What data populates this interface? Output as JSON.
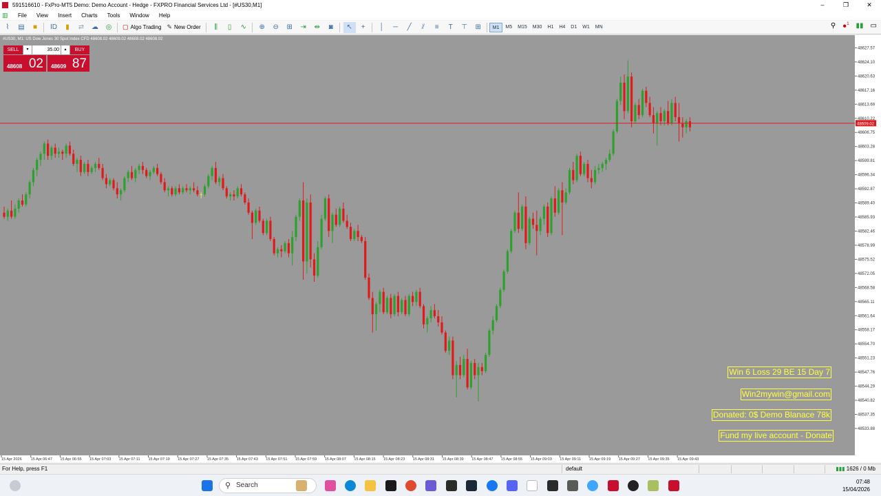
{
  "window": {
    "title": "591516610 - FxPro-MT5 Demo: Demo Account - Hedge - FXPRO Financial Services Ltd - [#US30,M1]",
    "controls": [
      "–",
      "❐",
      "✕"
    ]
  },
  "menu": [
    "File",
    "View",
    "Insert",
    "Charts",
    "Tools",
    "Window",
    "Help"
  ],
  "toolbar": {
    "algo_trading": "Algo Trading",
    "new_order": "New Order",
    "timeframes": [
      "M1",
      "M5",
      "M15",
      "M30",
      "H1",
      "H4",
      "D1",
      "W1",
      "MN"
    ],
    "active_timeframe": "M1",
    "notification_count": "1"
  },
  "chart": {
    "header": "#US30, M1: US Dow Jones 30 Spot Index CFD  48608.02 48609.02 48608.02 48608.02",
    "trade_panel": {
      "sell_label": "SELL",
      "buy_label": "BUY",
      "volume": "35.00",
      "bid_small": "48608",
      "bid_big": "02",
      "ask_small": "48609",
      "ask_big": "87"
    },
    "current_price_label": "48609.02",
    "overlay_labels": [
      "Win 6  Loss 29  BE 15  Day 7",
      "Win2mywin@gmail.com",
      "Donated: 0$  Demo Blanace 78k",
      "Fund my live account - Donate"
    ],
    "colors": {
      "background": "#9a9a9a",
      "bull": "#2ea02e",
      "bear": "#e01a1a",
      "doji": "#e8e860",
      "bid_line": "#e01a1a",
      "label_text": "#ffff40"
    }
  },
  "chart_data": {
    "type": "candlestick",
    "y_ticks": [
      "48627.57",
      "48624.10",
      "48620.63",
      "48617.16",
      "48613.69",
      "48610.22",
      "48606.75",
      "48603.28",
      "48599.81",
      "48596.34",
      "48592.87",
      "48589.40",
      "48585.93",
      "48582.46",
      "48578.99",
      "48575.52",
      "48572.05",
      "48568.58",
      "48565.11",
      "48561.64",
      "48558.17",
      "48554.70",
      "48551.23",
      "48547.76",
      "48544.29",
      "48540.82",
      "48537.35",
      "48533.88"
    ],
    "x_ticks": [
      "15 Apr 2026",
      "15 Apr 06:47",
      "15 Apr 06:55",
      "15 Apr 07:03",
      "15 Apr 07:11",
      "15 Apr 07:19",
      "15 Apr 07:27",
      "15 Apr 07:35",
      "15 Apr 07:43",
      "15 Apr 07:51",
      "15 Apr 07:59",
      "15 Apr 08:07",
      "15 Apr 08:15",
      "15 Apr 08:23",
      "15 Apr 08:31",
      "15 Apr 08:39",
      "15 Apr 08:47",
      "15 Apr 08:55",
      "15 Apr 09:03",
      "15 Apr 09:11",
      "15 Apr 09:19",
      "15 Apr 09:27",
      "15 Apr 09:35",
      "15 Apr 09:43"
    ],
    "ylim": [
      48531.5,
      48629.0
    ],
    "bid_price": 48609.02,
    "ohlc": [
      [
        48587.0,
        48588.5,
        48585.5,
        48586.0
      ],
      [
        48586.0,
        48588.0,
        48585.0,
        48587.5
      ],
      [
        48587.5,
        48590.0,
        48585.5,
        48586.0
      ],
      [
        48586.0,
        48589.0,
        48585.5,
        48588.0
      ],
      [
        48588.0,
        48590.5,
        48587.0,
        48590.0
      ],
      [
        48590.0,
        48591.5,
        48588.5,
        48589.0
      ],
      [
        48589.0,
        48592.0,
        48588.5,
        48591.5
      ],
      [
        48591.5,
        48595.0,
        48590.5,
        48594.5
      ],
      [
        48594.5,
        48598.0,
        48593.5,
        48597.5
      ],
      [
        48597.5,
        48600.5,
        48596.0,
        48600.0
      ],
      [
        48600.0,
        48602.0,
        48598.5,
        48601.5
      ],
      [
        48601.5,
        48604.5,
        48600.0,
        48604.0
      ],
      [
        48604.0,
        48605.0,
        48600.0,
        48601.0
      ],
      [
        48601.0,
        48603.5,
        48600.0,
        48603.0
      ],
      [
        48603.0,
        48604.0,
        48600.5,
        48601.5
      ],
      [
        48601.5,
        48603.0,
        48600.5,
        48602.0
      ],
      [
        48602.0,
        48602.5,
        48600.0,
        48601.5
      ],
      [
        48601.5,
        48604.0,
        48600.5,
        48603.5
      ],
      [
        48603.5,
        48604.5,
        48601.0,
        48601.5
      ],
      [
        48601.5,
        48602.5,
        48598.5,
        48599.0
      ],
      [
        48599.0,
        48600.5,
        48597.0,
        48600.0
      ],
      [
        48600.0,
        48601.0,
        48596.0,
        48597.0
      ],
      [
        48597.0,
        48599.5,
        48596.5,
        48599.0
      ],
      [
        48599.0,
        48600.0,
        48596.0,
        48597.0
      ],
      [
        48597.0,
        48598.5,
        48596.5,
        48598.0
      ],
      [
        48598.0,
        48599.5,
        48597.0,
        48599.0
      ],
      [
        48599.0,
        48600.5,
        48597.5,
        48598.0
      ],
      [
        48598.0,
        48599.0,
        48595.0,
        48595.5
      ],
      [
        48595.5,
        48596.5,
        48593.0,
        48594.0
      ],
      [
        48594.0,
        48595.5,
        48593.5,
        48595.0
      ],
      [
        48595.0,
        48595.5,
        48592.5,
        48593.0
      ],
      [
        48593.0,
        48594.5,
        48590.5,
        48591.5
      ],
      [
        48591.5,
        48593.0,
        48590.0,
        48592.5
      ],
      [
        48592.5,
        48596.0,
        48592.0,
        48595.5
      ],
      [
        48595.5,
        48597.5,
        48594.5,
        48597.0
      ],
      [
        48597.0,
        48598.5,
        48595.0,
        48595.5
      ],
      [
        48595.5,
        48598.0,
        48594.5,
        48597.5
      ],
      [
        48597.5,
        48599.0,
        48596.5,
        48598.5
      ],
      [
        48598.5,
        48599.5,
        48596.5,
        48597.5
      ],
      [
        48597.5,
        48598.0,
        48595.5,
        48596.0
      ],
      [
        48596.0,
        48597.5,
        48595.0,
        48597.0
      ],
      [
        48597.0,
        48598.5,
        48596.5,
        48598.0
      ],
      [
        48598.0,
        48599.0,
        48596.0,
        48596.5
      ],
      [
        48596.5,
        48597.0,
        48594.0,
        48594.5
      ],
      [
        48594.5,
        48595.5,
        48592.0,
        48592.5
      ],
      [
        48592.5,
        48593.5,
        48591.0,
        48593.0
      ],
      [
        48593.0,
        48593.5,
        48591.0,
        48591.5
      ],
      [
        48591.5,
        48593.5,
        48591.0,
        48593.0
      ],
      [
        48593.0,
        48594.0,
        48591.5,
        48592.0
      ],
      [
        48592.0,
        48593.5,
        48591.5,
        48593.0
      ],
      [
        48593.0,
        48594.0,
        48592.0,
        48592.5
      ],
      [
        48592.5,
        48593.5,
        48591.5,
        48593.0
      ],
      [
        48593.0,
        48594.5,
        48592.0,
        48592.5
      ],
      [
        48592.5,
        48593.5,
        48591.0,
        48591.5
      ],
      [
        48591.5,
        48592.0,
        48590.5,
        48591.5
      ],
      [
        48591.5,
        48594.0,
        48591.0,
        48593.5
      ],
      [
        48593.5,
        48596.5,
        48593.0,
        48596.0
      ],
      [
        48596.0,
        48598.5,
        48595.0,
        48598.0
      ],
      [
        48598.0,
        48599.5,
        48594.0,
        48594.5
      ],
      [
        48594.5,
        48596.0,
        48593.5,
        48595.5
      ],
      [
        48595.5,
        48596.5,
        48592.5,
        48593.0
      ],
      [
        48593.0,
        48593.5,
        48590.5,
        48591.0
      ],
      [
        48591.0,
        48592.0,
        48590.0,
        48591.5
      ],
      [
        48591.5,
        48592.5,
        48590.0,
        48591.0
      ],
      [
        48591.0,
        48593.5,
        48590.5,
        48593.0
      ],
      [
        48593.0,
        48594.0,
        48591.0,
        48591.5
      ],
      [
        48591.5,
        48592.0,
        48589.0,
        48589.5
      ],
      [
        48589.5,
        48590.5,
        48586.5,
        48587.0
      ],
      [
        48587.0,
        48587.5,
        48580.5,
        48584.5
      ],
      [
        48584.5,
        48588.0,
        48584.0,
        48587.5
      ],
      [
        48587.5,
        48588.5,
        48584.5,
        48585.0
      ],
      [
        48585.0,
        48585.5,
        48581.5,
        48582.0
      ],
      [
        48582.0,
        48585.5,
        48581.5,
        48585.0
      ],
      [
        48585.0,
        48586.0,
        48580.0,
        48580.5
      ],
      [
        48580.5,
        48581.0,
        48576.5,
        48577.0
      ],
      [
        48577.0,
        48578.5,
        48576.0,
        48578.0
      ],
      [
        48578.0,
        48579.0,
        48576.0,
        48577.5
      ],
      [
        48577.5,
        48580.0,
        48577.0,
        48579.5
      ],
      [
        48579.5,
        48580.5,
        48576.0,
        48577.0
      ],
      [
        48577.0,
        48582.5,
        48574.0,
        48581.0
      ],
      [
        48581.0,
        48586.5,
        48580.0,
        48586.0
      ],
      [
        48586.0,
        48590.5,
        48585.0,
        48590.0
      ],
      [
        48590.0,
        48594.5,
        48570.5,
        48575.0
      ],
      [
        48575.0,
        48590.5,
        48572.0,
        48589.5
      ],
      [
        48589.5,
        48591.5,
        48573.5,
        48575.5
      ],
      [
        48575.5,
        48577.0,
        48570.0,
        48571.5
      ],
      [
        48571.5,
        48580.0,
        48571.0,
        48578.5
      ],
      [
        48578.5,
        48586.5,
        48578.0,
        48585.5
      ],
      [
        48585.5,
        48591.0,
        48585.0,
        48590.5
      ],
      [
        48590.5,
        48591.5,
        48581.0,
        48582.5
      ],
      [
        48582.5,
        48587.0,
        48579.5,
        48586.5
      ],
      [
        48586.5,
        48588.0,
        48583.5,
        48584.0
      ],
      [
        48584.0,
        48588.5,
        48583.5,
        48588.0
      ],
      [
        48588.0,
        48589.5,
        48584.5,
        48585.0
      ],
      [
        48585.0,
        48586.5,
        48583.0,
        48583.5
      ],
      [
        48583.5,
        48584.5,
        48580.0,
        48580.5
      ],
      [
        48580.5,
        48583.0,
        48580.0,
        48582.5
      ],
      [
        48582.5,
        48584.0,
        48580.0,
        48581.0
      ],
      [
        48581.0,
        48581.5,
        48579.5,
        48580.0
      ],
      [
        48580.0,
        48581.0,
        48570.5,
        48571.0
      ],
      [
        48571.0,
        48572.0,
        48565.5,
        48566.0
      ],
      [
        48566.0,
        48567.5,
        48557.5,
        48562.0
      ],
      [
        48562.0,
        48565.0,
        48558.0,
        48564.5
      ],
      [
        48564.5,
        48568.0,
        48562.5,
        48567.5
      ],
      [
        48567.5,
        48568.5,
        48562.0,
        48562.5
      ],
      [
        48562.5,
        48566.5,
        48562.0,
        48566.0
      ],
      [
        48566.0,
        48567.0,
        48561.0,
        48562.0
      ],
      [
        48562.0,
        48567.0,
        48561.5,
        48566.5
      ],
      [
        48566.5,
        48567.5,
        48561.5,
        48562.5
      ],
      [
        48562.5,
        48566.0,
        48562.0,
        48565.5
      ],
      [
        48565.5,
        48566.5,
        48561.5,
        48562.0
      ],
      [
        48562.0,
        48567.0,
        48561.5,
        48566.5
      ],
      [
        48566.5,
        48567.5,
        48564.0,
        48565.0
      ],
      [
        48565.0,
        48568.0,
        48564.0,
        48567.5
      ],
      [
        48567.5,
        48568.5,
        48563.5,
        48564.0
      ],
      [
        48564.0,
        48564.5,
        48558.5,
        48559.5
      ],
      [
        48559.5,
        48561.5,
        48557.5,
        48561.0
      ],
      [
        48561.0,
        48564.0,
        48560.0,
        48563.0
      ],
      [
        48563.0,
        48564.5,
        48561.0,
        48561.5
      ],
      [
        48561.5,
        48563.0,
        48559.0,
        48560.0
      ],
      [
        48560.0,
        48561.5,
        48557.0,
        48557.5
      ],
      [
        48557.5,
        48558.0,
        48552.5,
        48553.0
      ],
      [
        48553.0,
        48556.5,
        48552.0,
        48555.5
      ],
      [
        48555.5,
        48556.5,
        48546.0,
        48547.0
      ],
      [
        48547.0,
        48550.5,
        48541.5,
        48549.5
      ],
      [
        48549.5,
        48551.5,
        48546.0,
        48547.0
      ],
      [
        48547.0,
        48552.0,
        48546.5,
        48551.0
      ],
      [
        48551.0,
        48553.5,
        48543.5,
        48544.0
      ],
      [
        48544.0,
        48550.5,
        48543.5,
        48550.0
      ],
      [
        48550.0,
        48551.0,
        48546.0,
        48547.0
      ],
      [
        48547.0,
        48550.0,
        48540.5,
        48549.0
      ],
      [
        48549.0,
        48550.0,
        48547.0,
        48548.0
      ],
      [
        48548.0,
        48552.5,
        48547.5,
        48552.0
      ],
      [
        48552.0,
        48558.5,
        48551.5,
        48558.0
      ],
      [
        48558.0,
        48561.5,
        48557.0,
        48560.5
      ],
      [
        48560.5,
        48564.5,
        48560.0,
        48564.0
      ],
      [
        48564.0,
        48568.5,
        48563.5,
        48568.0
      ],
      [
        48568.0,
        48573.0,
        48567.5,
        48572.5
      ],
      [
        48572.5,
        48578.0,
        48572.0,
        48577.5
      ],
      [
        48577.5,
        48583.0,
        48577.0,
        48582.5
      ],
      [
        48582.5,
        48587.5,
        48582.0,
        48587.0
      ],
      [
        48587.0,
        48592.0,
        48582.0,
        48583.0
      ],
      [
        48583.0,
        48589.0,
        48582.5,
        48588.5
      ],
      [
        48588.5,
        48591.0,
        48578.0,
        48579.5
      ],
      [
        48579.5,
        48586.0,
        48579.0,
        48585.5
      ],
      [
        48585.5,
        48587.0,
        48583.0,
        48584.0
      ],
      [
        48584.0,
        48587.5,
        48576.5,
        48582.5
      ],
      [
        48582.5,
        48586.0,
        48581.5,
        48585.5
      ],
      [
        48585.5,
        48589.0,
        48584.0,
        48588.5
      ],
      [
        48588.5,
        48589.5,
        48581.0,
        48582.0
      ],
      [
        48582.0,
        48591.0,
        48581.5,
        48590.5
      ],
      [
        48590.5,
        48593.5,
        48586.0,
        48587.0
      ],
      [
        48587.0,
        48593.0,
        48586.5,
        48592.5
      ],
      [
        48592.5,
        48594.5,
        48581.5,
        48589.5
      ],
      [
        48589.5,
        48593.0,
        48589.0,
        48592.0
      ],
      [
        48592.0,
        48598.0,
        48591.5,
        48597.5
      ],
      [
        48597.5,
        48599.5,
        48594.0,
        48595.0
      ],
      [
        48595.0,
        48601.5,
        48594.5,
        48601.0
      ],
      [
        48601.0,
        48602.0,
        48596.0,
        48596.5
      ],
      [
        48596.5,
        48599.5,
        48596.0,
        48599.0
      ],
      [
        48599.0,
        48600.0,
        48594.5,
        48595.5
      ],
      [
        48595.5,
        48597.5,
        48593.0,
        48594.5
      ],
      [
        48594.5,
        48598.5,
        48594.0,
        48597.5
      ],
      [
        48597.5,
        48599.0,
        48596.5,
        48598.0
      ],
      [
        48598.0,
        48599.5,
        48597.0,
        48599.0
      ],
      [
        48599.0,
        48600.5,
        48597.5,
        48600.0
      ],
      [
        48600.0,
        48602.5,
        48599.5,
        48601.5
      ],
      [
        48601.5,
        48607.5,
        48601.0,
        48607.0
      ],
      [
        48607.0,
        48615.0,
        48606.5,
        48614.5
      ],
      [
        48614.5,
        48620.5,
        48613.5,
        48619.0
      ],
      [
        48619.0,
        48621.0,
        48610.0,
        48612.0
      ],
      [
        48612.0,
        48624.5,
        48611.5,
        48620.5
      ],
      [
        48620.5,
        48621.5,
        48608.0,
        48609.5
      ],
      [
        48609.5,
        48614.0,
        48609.0,
        48613.5
      ],
      [
        48613.5,
        48615.0,
        48610.0,
        48611.0
      ],
      [
        48611.0,
        48617.5,
        48610.5,
        48617.0
      ],
      [
        48617.0,
        48618.0,
        48613.0,
        48614.0
      ],
      [
        48614.0,
        48615.5,
        48610.5,
        48611.0
      ],
      [
        48611.0,
        48613.0,
        48606.5,
        48609.0
      ],
      [
        48609.0,
        48612.0,
        48603.5,
        48611.5
      ],
      [
        48611.5,
        48613.0,
        48608.5,
        48609.5
      ],
      [
        48609.5,
        48612.5,
        48608.5,
        48612.0
      ],
      [
        48612.0,
        48614.5,
        48608.5,
        48609.0
      ],
      [
        48609.0,
        48615.0,
        48608.5,
        48614.0
      ],
      [
        48614.0,
        48615.5,
        48609.5,
        48610.5
      ],
      [
        48610.5,
        48614.0,
        48604.5,
        48609.0
      ],
      [
        48609.0,
        48610.5,
        48605.5,
        48608.0
      ],
      [
        48608.0,
        48610.0,
        48606.5,
        48609.5
      ],
      [
        48609.5,
        48610.5,
        48607.0,
        48608.0
      ]
    ]
  },
  "status_bar": {
    "help": "For Help, press F1",
    "profile": "default",
    "traffic": "1626 / 0 Mb"
  },
  "taskbar": {
    "search_placeholder": "Search",
    "time": "07:48",
    "date": "15/04/2026"
  }
}
